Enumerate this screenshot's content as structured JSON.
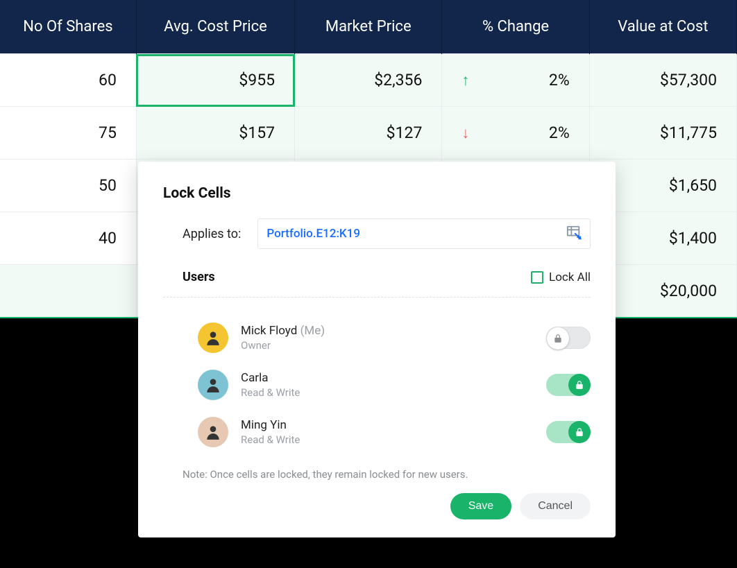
{
  "table": {
    "headers": [
      "No Of Shares",
      "Avg. Cost Price",
      "Market Price",
      "% Change",
      "Value at Cost"
    ],
    "rows": [
      {
        "shares": "60",
        "avg": "$955",
        "market": "$2,356",
        "change_dir": "up",
        "change": "2%",
        "value": "$57,300"
      },
      {
        "shares": "75",
        "avg": "$157",
        "market": "$127",
        "change_dir": "down",
        "change": "2%",
        "value": "$11,775"
      },
      {
        "shares": "50",
        "avg": "",
        "market": "",
        "change_dir": "",
        "change": "",
        "value": "$1,650"
      },
      {
        "shares": "40",
        "avg": "",
        "market": "",
        "change_dir": "",
        "change": "",
        "value": "$1,400"
      },
      {
        "shares": "",
        "avg": "",
        "market": "",
        "change_dir": "",
        "change": "",
        "value": "$20,000"
      }
    ]
  },
  "modal": {
    "title": "Lock Cells",
    "applies_label": "Applies to:",
    "range": "Portfolio.E12:K19",
    "users_title": "Users",
    "lock_all_label": "Lock All",
    "lock_all_checked": false,
    "users": [
      {
        "name": "Mick Floyd",
        "suffix": "(Me)",
        "role": "Owner",
        "locked": false,
        "color": "c0"
      },
      {
        "name": "Carla",
        "suffix": "",
        "role": "Read & Write",
        "locked": true,
        "color": "c1"
      },
      {
        "name": "Ming Yin",
        "suffix": "",
        "role": "Read & Write",
        "locked": true,
        "color": "c2"
      }
    ],
    "note": "Note: Once cells are locked, they remain locked for new users.",
    "save_label": "Save",
    "cancel_label": "Cancel"
  },
  "colors": {
    "accent": "#19b46a",
    "header_bg": "#11264a",
    "link": "#1a6dff",
    "down": "#e66262"
  }
}
